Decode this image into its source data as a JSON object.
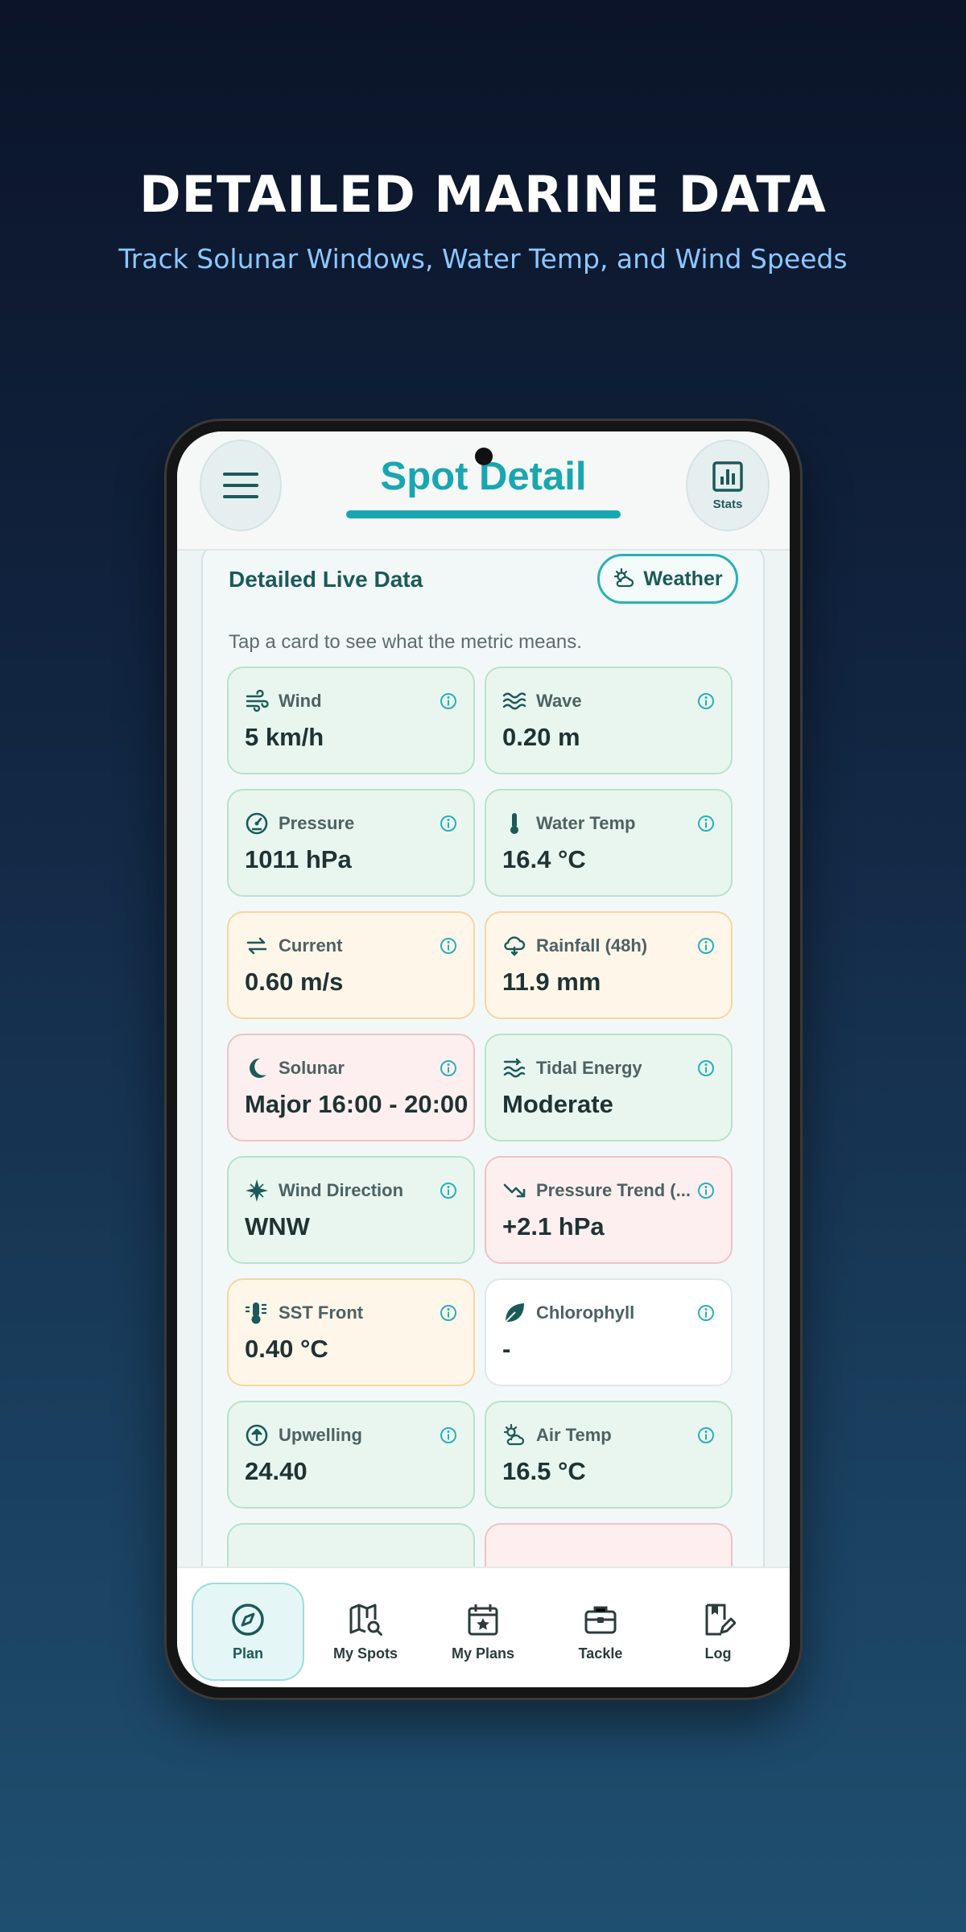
{
  "hero": {
    "title": "DETAILED MARINE DATA",
    "subtitle": "Track Solunar Windows, Water Temp, and Wind Speeds"
  },
  "app_bar": {
    "title": "Spot Detail",
    "menu_icon": "hamburger-menu-icon",
    "stats_label": "Stats",
    "stats_icon": "bar-chart-icon"
  },
  "live_data": {
    "title": "Detailed Live Data",
    "weather_button": "Weather",
    "hint": "Tap a card to see what the metric means.",
    "cards": [
      {
        "label": "Wind",
        "value": "5 km/h",
        "icon": "wind-icon",
        "status": "green"
      },
      {
        "label": "Wave",
        "value": "0.20 m",
        "icon": "wave-icon",
        "status": "green"
      },
      {
        "label": "Pressure",
        "value": "1011 hPa",
        "icon": "gauge-icon",
        "status": "green"
      },
      {
        "label": "Water Temp",
        "value": "16.4 °C",
        "icon": "thermometer-icon",
        "status": "green"
      },
      {
        "label": "Current",
        "value": "0.60 m/s",
        "icon": "swap-arrows-icon",
        "status": "orange"
      },
      {
        "label": "Rainfall (48h)",
        "value": "11.9 mm",
        "icon": "rain-cloud-icon",
        "status": "orange"
      },
      {
        "label": "Solunar",
        "value": "Major 16:00 - 20:00",
        "icon": "moon-icon",
        "status": "red"
      },
      {
        "label": "Tidal Energy",
        "value": "Moderate",
        "icon": "tidal-flow-icon",
        "status": "green"
      },
      {
        "label": "Wind Direction",
        "value": "WNW",
        "icon": "compass-rose-icon",
        "status": "green"
      },
      {
        "label": "Pressure Trend (...",
        "value": "+2.1 hPa",
        "icon": "trend-down-icon",
        "status": "red"
      },
      {
        "label": "SST Front",
        "value": "0.40 °C",
        "icon": "thermometer-lines-icon",
        "status": "orange"
      },
      {
        "label": "Chlorophyll",
        "value": "-",
        "icon": "leaf-icon",
        "status": "white"
      },
      {
        "label": "Upwelling",
        "value": "24.40",
        "icon": "arrow-up-circle-icon",
        "status": "green"
      },
      {
        "label": "Air Temp",
        "value": "16.5 °C",
        "icon": "sun-cloud-icon",
        "status": "green"
      }
    ]
  },
  "bottom_nav": {
    "items": [
      {
        "label": "Plan",
        "icon": "compass-icon",
        "active": true
      },
      {
        "label": "My Spots",
        "icon": "map-search-icon",
        "active": false
      },
      {
        "label": "My Plans",
        "icon": "calendar-star-icon",
        "active": false
      },
      {
        "label": "Tackle",
        "icon": "tackle-box-icon",
        "active": false
      },
      {
        "label": "Log",
        "icon": "logbook-icon",
        "active": false
      }
    ]
  },
  "colors": {
    "accent": "#18a7b0",
    "dark_teal": "#1b5a58",
    "status_green_bg": "#e9f6ef",
    "status_orange_bg": "#fff6ea",
    "status_red_bg": "#fdeff0"
  }
}
